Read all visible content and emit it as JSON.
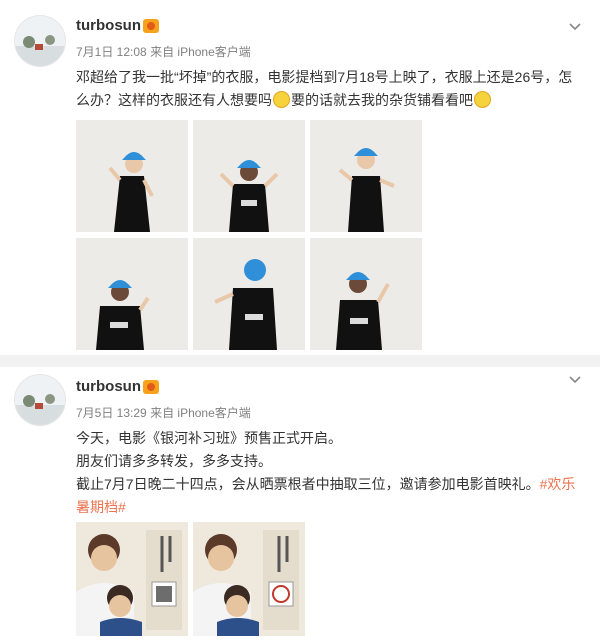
{
  "post1": {
    "username": "turbosun",
    "time": "7月1日 12:08",
    "source": "来自 iPhone客户端",
    "text_line1": "邓超给了我一批“坏掉”的衣服，电影提档到7月18号上映了，衣服上还是26号，怎",
    "text_line2a": "么办？这样的衣服还有人想要吗",
    "text_line2b": "要的话就去我的杂货铺看看吧",
    "emoji_names": [
      "smile-emoji",
      "grin-emoji"
    ]
  },
  "post2": {
    "username": "turbosun",
    "time": "7月5日 13:29",
    "source": "来自 iPhone客户端",
    "line1": "今天，电影《银河补习班》预售正式开启。",
    "line2": "朋友们请多多转发，多多支持。",
    "line3": "截止7月7日晚二十四点，会从晒票根者中抽取三位，邀请参加电影首映礼。",
    "tag_part1": "#欢乐",
    "tag_part2": "暑期档#"
  },
  "colors": {
    "link": "#eb7350",
    "cap_blue": "#2f8fd8",
    "shirt": "#111111",
    "background": "#ffffff",
    "separator": "#f2f2f2"
  }
}
